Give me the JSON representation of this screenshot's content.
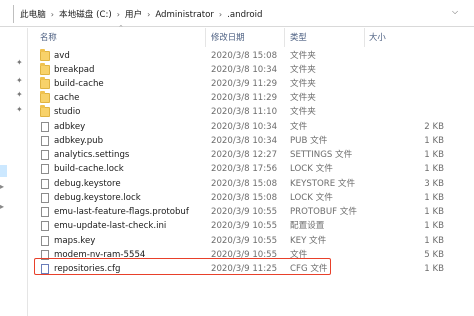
{
  "address_bar": {
    "crumbs": [
      "此电脑",
      "本地磁盘 (C:)",
      "用户",
      "Administrator",
      ".android"
    ],
    "separator": "›"
  },
  "columns": {
    "name": "名称",
    "date": "修改日期",
    "type": "类型",
    "size": "大小"
  },
  "files": [
    {
      "name": "avd",
      "date": "2020/3/8 15:08",
      "type": "文件夹",
      "size": "",
      "icon": "folder-icon"
    },
    {
      "name": "breakpad",
      "date": "2020/3/8 10:34",
      "type": "文件夹",
      "size": "",
      "icon": "folder-icon"
    },
    {
      "name": "build-cache",
      "date": "2020/3/9 11:29",
      "type": "文件夹",
      "size": "",
      "icon": "folder-icon"
    },
    {
      "name": "cache",
      "date": "2020/3/8 11:29",
      "type": "文件夹",
      "size": "",
      "icon": "folder-icon"
    },
    {
      "name": "studio",
      "date": "2020/3/8 11:10",
      "type": "文件夹",
      "size": "",
      "icon": "folder-icon"
    },
    {
      "name": "adbkey",
      "date": "2020/3/8 10:34",
      "type": "文件",
      "size": "2 KB",
      "icon": "file-icon"
    },
    {
      "name": "adbkey.pub",
      "date": "2020/3/8 10:34",
      "type": "PUB 文件",
      "size": "1 KB",
      "icon": "file-icon"
    },
    {
      "name": "analytics.settings",
      "date": "2020/3/8 12:27",
      "type": "SETTINGS 文件",
      "size": "1 KB",
      "icon": "file-icon"
    },
    {
      "name": "build-cache.lock",
      "date": "2020/3/8 17:56",
      "type": "LOCK 文件",
      "size": "1 KB",
      "icon": "file-icon"
    },
    {
      "name": "debug.keystore",
      "date": "2020/3/8 15:08",
      "type": "KEYSTORE 文件",
      "size": "3 KB",
      "icon": "file-icon"
    },
    {
      "name": "debug.keystore.lock",
      "date": "2020/3/8 15:08",
      "type": "LOCK 文件",
      "size": "1 KB",
      "icon": "file-icon"
    },
    {
      "name": "emu-last-feature-flags.protobuf",
      "date": "2020/3/9 10:55",
      "type": "PROTOBUF 文件",
      "size": "1 KB",
      "icon": "file-icon"
    },
    {
      "name": "emu-update-last-check.ini",
      "date": "2020/3/9 10:55",
      "type": "配置设置",
      "size": "1 KB",
      "icon": "settings-file-icon"
    },
    {
      "name": "maps.key",
      "date": "2020/3/9 10:55",
      "type": "KEY 文件",
      "size": "1 KB",
      "icon": "file-icon"
    },
    {
      "name": "modem-nv-ram-5554",
      "date": "2020/3/9 10:55",
      "type": "文件",
      "size": "5 KB",
      "icon": "file-icon"
    },
    {
      "name": "repositories.cfg",
      "date": "2020/3/9 11:25",
      "type": "CFG 文件",
      "size": "1 KB",
      "icon": "cfg-file-icon",
      "highlighted": true
    }
  ],
  "colors": {
    "header_text": "#4d6082",
    "highlight_border": "#e8402a",
    "folder": "#f8d26a"
  }
}
